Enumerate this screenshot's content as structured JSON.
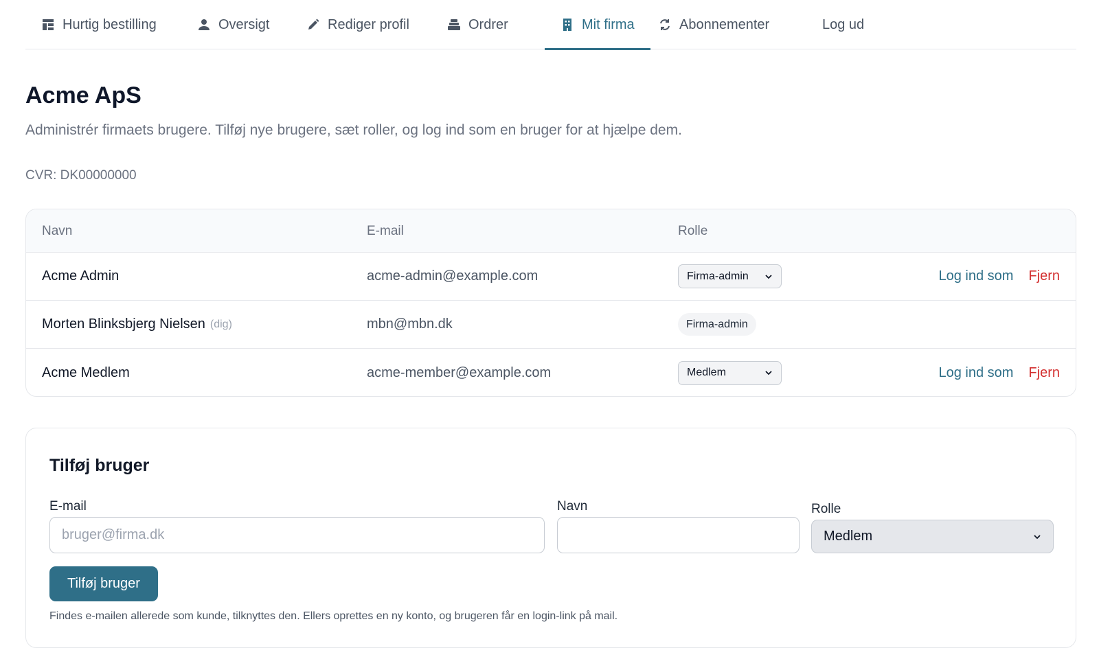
{
  "nav": {
    "tabs": [
      {
        "label": "Hurtig bestilling",
        "icon": "grid-icon"
      },
      {
        "label": "Oversigt",
        "icon": "user-icon"
      },
      {
        "label": "Rediger profil",
        "icon": "pencil-icon"
      },
      {
        "label": "Ordrer",
        "icon": "stack-icon"
      },
      {
        "label": "Mit firma",
        "icon": "building-icon",
        "active": true
      },
      {
        "label": "Abonnementer",
        "icon": "refresh-icon"
      },
      {
        "label": "Log ud"
      }
    ]
  },
  "company": {
    "name": "Acme ApS",
    "description": "Administrér firmaets brugere. Tilføj nye brugere, sæt roller, og log ind som en bruger for at hjælpe dem.",
    "cvr": "CVR: DK00000000"
  },
  "users_table": {
    "headers": [
      "Navn",
      "E-mail",
      "Rolle"
    ],
    "rows": [
      {
        "name": "Acme Admin",
        "email": "acme-admin@example.com",
        "role": "Firma-admin",
        "login_label": "Log ind som",
        "remove_label": "Fjern"
      },
      {
        "name": "Morten Blinksbjerg Nielsen",
        "you_tag": "(dig)",
        "email": "mbn@mbn.dk",
        "role": "Firma-admin"
      },
      {
        "name": "Acme Medlem",
        "email": "acme-member@example.com",
        "role": "Medlem",
        "login_label": "Log ind som",
        "remove_label": "Fjern"
      }
    ]
  },
  "add_user": {
    "title": "Tilføj bruger",
    "email_label": "E-mail",
    "email_placeholder": "bruger@firma.dk",
    "name_label": "Navn",
    "name_value": "",
    "role_label": "Rolle",
    "role_selected": "Medlem",
    "submit_label": "Tilføj bruger",
    "help_text": "Findes e-mailen allerede som kunde, tilknyttes den. Ellers oprettes en ny konto, og brugeren får en login-link på mail."
  },
  "colors": {
    "accent": "#2f6f88",
    "danger": "#d32f2f",
    "muted_text": "#6b7280",
    "border": "#e5e7eb"
  }
}
